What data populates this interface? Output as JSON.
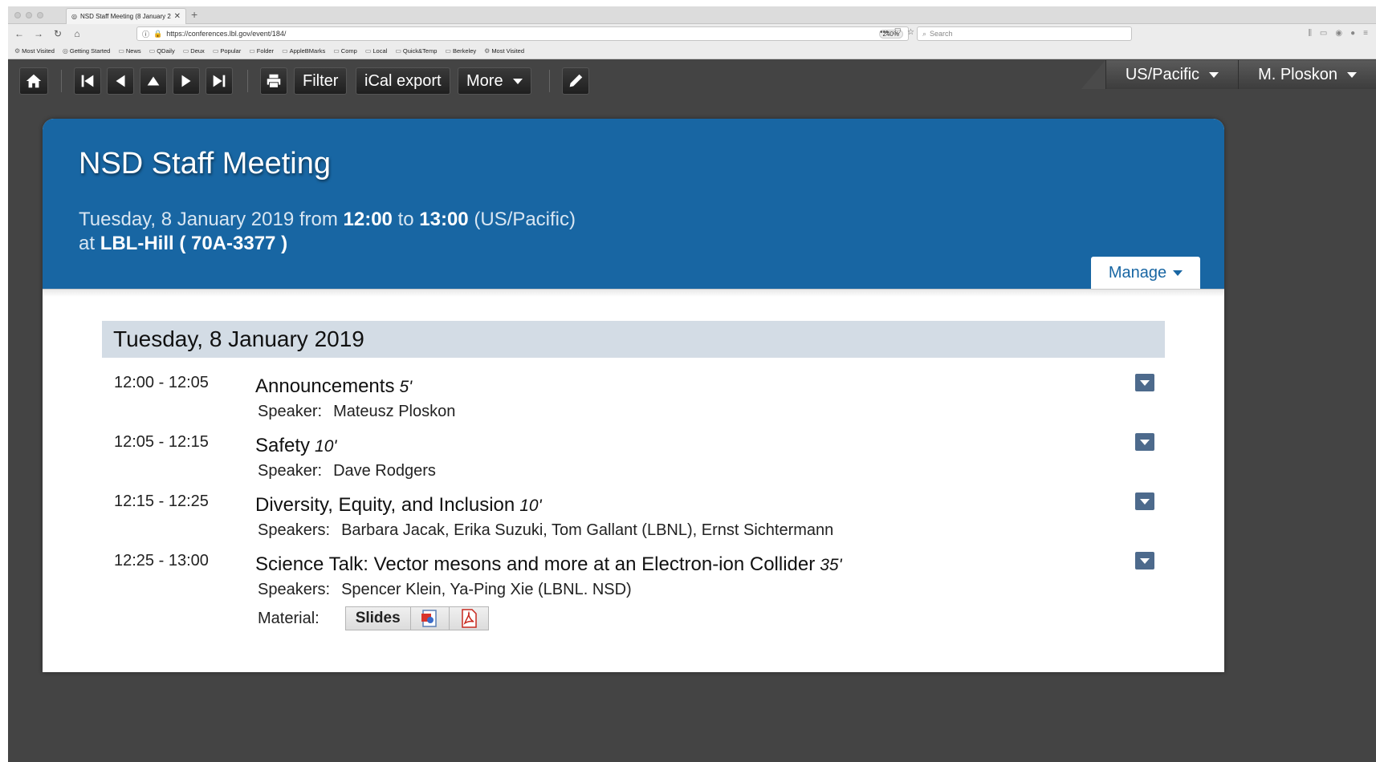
{
  "browser": {
    "tab_title": "NSD Staff Meeting (8 January 2",
    "url": "https://conferences.lbl.gov/event/184/",
    "zoom": "240%",
    "search_placeholder": "Search",
    "bookmarks": [
      "Most Visited",
      "Getting Started",
      "News",
      "QDaily",
      "Deux",
      "Popular",
      "Folder",
      "AppleBMarks",
      "Comp",
      "Local",
      "Quick&Temp",
      "Berkeley",
      "Most Visited"
    ]
  },
  "toolbar": {
    "filter_label": "Filter",
    "ical_label": "iCal export",
    "more_label": "More",
    "timezone_label": "US/Pacific",
    "user_label": "M. Ploskon"
  },
  "event": {
    "title": "NSD Staff Meeting",
    "date_prefix": "Tuesday, 8 January 2019 from ",
    "start": "12:00",
    "to": " to ",
    "end": "13:00",
    "tz": " (US/Pacific)",
    "at": "at ",
    "location": "LBL-Hill ( 70A-3377 )",
    "manage_label": "Manage"
  },
  "day": {
    "label": "Tuesday, 8 January 2019"
  },
  "entries": [
    {
      "time": "12:00 - 12:05",
      "title": "Announcements",
      "duration": "5'",
      "speaker_label": "Speaker:",
      "speakers": "Mateusz Ploskon"
    },
    {
      "time": "12:05 - 12:15",
      "title": "Safety",
      "duration": "10'",
      "speaker_label": "Speaker:",
      "speakers": "Dave Rodgers"
    },
    {
      "time": "12:15 - 12:25",
      "title": "Diversity, Equity, and Inclusion",
      "duration": "10'",
      "speaker_label": "Speakers:",
      "speakers": "Barbara Jacak, Erika Suzuki, Tom Gallant (LBNL), Ernst Sichtermann"
    },
    {
      "time": "12:25 - 13:00",
      "title": "Science Talk: Vector mesons and more at an Electron-ion Collider",
      "duration": "35'",
      "speaker_label": "Speakers:",
      "speakers": "Spencer Klein, Ya-Ping Xie (LBNL. NSD)",
      "material_label": "Material:",
      "slides_label": "Slides"
    }
  ]
}
